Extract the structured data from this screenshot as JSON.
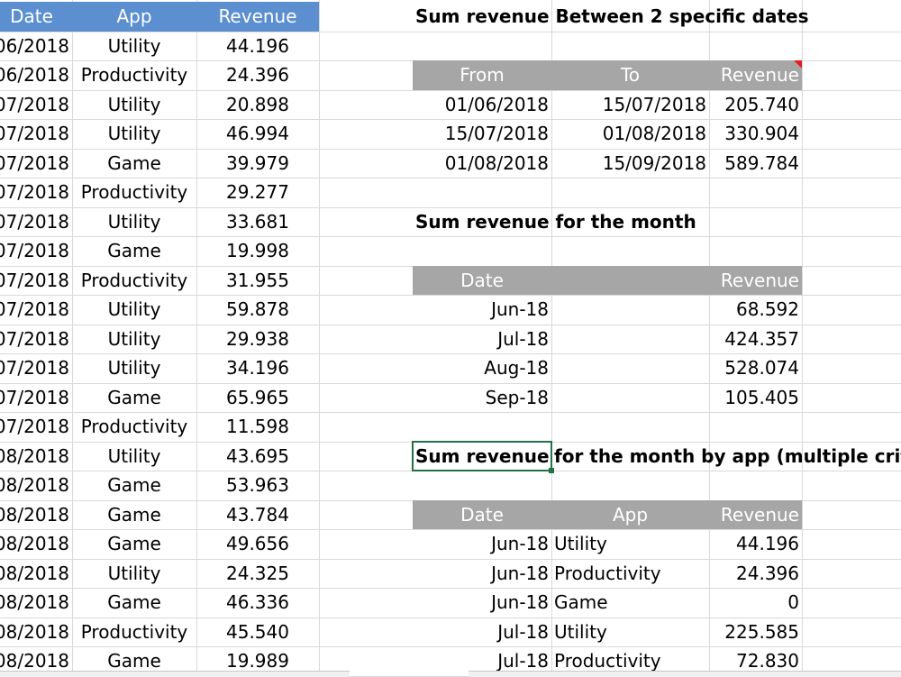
{
  "left_table": {
    "headers": [
      "Date",
      "App",
      "Revenue"
    ],
    "rows": [
      [
        "06/2018",
        "Utility",
        "44.196"
      ],
      [
        "06/2018",
        "Productivity",
        "24.396"
      ],
      [
        "07/2018",
        "Utility",
        "20.898"
      ],
      [
        "07/2018",
        "Utility",
        "46.994"
      ],
      [
        "07/2018",
        "Game",
        "39.979"
      ],
      [
        "07/2018",
        "Productivity",
        "29.277"
      ],
      [
        "07/2018",
        "Utility",
        "33.681"
      ],
      [
        "07/2018",
        "Game",
        "19.998"
      ],
      [
        "07/2018",
        "Productivity",
        "31.955"
      ],
      [
        "07/2018",
        "Utility",
        "59.878"
      ],
      [
        "07/2018",
        "Utility",
        "29.938"
      ],
      [
        "07/2018",
        "Utility",
        "34.196"
      ],
      [
        "07/2018",
        "Game",
        "65.965"
      ],
      [
        "07/2018",
        "Productivity",
        "11.598"
      ],
      [
        "08/2018",
        "Utility",
        "43.695"
      ],
      [
        "08/2018",
        "Game",
        "53.963"
      ],
      [
        "08/2018",
        "Game",
        "43.784"
      ],
      [
        "08/2018",
        "Game",
        "49.656"
      ],
      [
        "08/2018",
        "Utility",
        "24.325"
      ],
      [
        "08/2018",
        "Game",
        "46.336"
      ],
      [
        "08/2018",
        "Productivity",
        "45.540"
      ],
      [
        "08/2018",
        "Game",
        "19.989"
      ]
    ]
  },
  "section1": {
    "title": "Sum revenue Between 2 specific dates",
    "headers": [
      "From",
      "To",
      "Revenue"
    ],
    "rows": [
      [
        "01/06/2018",
        "15/07/2018",
        "205.740"
      ],
      [
        "15/07/2018",
        "01/08/2018",
        "330.904"
      ],
      [
        "01/08/2018",
        "15/09/2018",
        "589.784"
      ]
    ]
  },
  "section2": {
    "title": "Sum revenue for the month",
    "headers": [
      "Date",
      "Revenue"
    ],
    "rows": [
      [
        "Jun-18",
        "68.592"
      ],
      [
        "Jul-18",
        "424.357"
      ],
      [
        "Aug-18",
        "528.074"
      ],
      [
        "Sep-18",
        "105.405"
      ]
    ]
  },
  "section3": {
    "title_part1": "Sum revenue",
    "title_part2": " for the month by app (multiple crit",
    "headers": [
      "Date",
      "App",
      "Revenue"
    ],
    "rows": [
      [
        "Jun-18",
        "Utility",
        "44.196"
      ],
      [
        "Jun-18",
        "Productivity",
        "24.396"
      ],
      [
        "Jun-18",
        "Game",
        "0"
      ],
      [
        "Jul-18",
        "Utility",
        "225.585"
      ],
      [
        "Jul-18",
        "Productivity",
        "72.830"
      ]
    ]
  },
  "colors": {
    "left_header": "#5b8fd0",
    "right_header": "#a6a6a6",
    "selection": "#217346",
    "comment_flag": "#e02020"
  }
}
